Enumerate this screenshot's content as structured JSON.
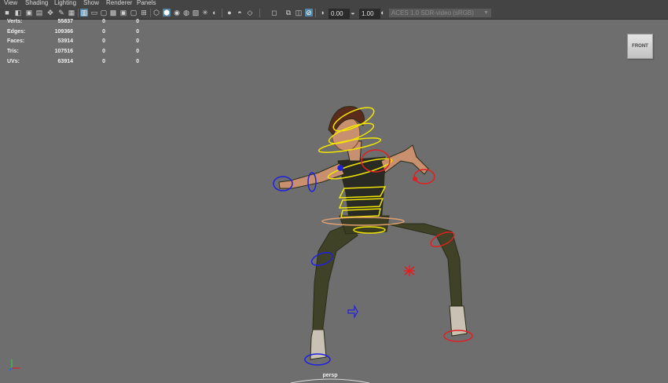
{
  "menu": [
    "View",
    "Shading",
    "Lighting",
    "Show",
    "Renderer",
    "Panels"
  ],
  "toolbar": {
    "exposure_value": "0.00",
    "gamma_value": "1.00",
    "color_space": "ACES 1.0 SDR-video (sRGB)",
    "icons": [
      "camera-select-icon",
      "camera-attributes-icon",
      "bookmarks-icon",
      "image-plane-icon",
      "2d-pan-zoom-icon",
      "grease-pencil-icon",
      "grid-icon",
      "film-gate-icon",
      "resolution-gate-icon",
      "gate-mask-icon",
      "field-chart-icon",
      "safe-action-icon",
      "safe-title-icon",
      "wireframe-icon",
      "smooth-shade-icon",
      "wireframe-on-shaded-icon",
      "textured-icon",
      "use-all-lights-icon",
      "shadows-icon",
      "screen-space-ao-icon",
      "motion-blur-icon",
      "multisample-aa-icon",
      "depth-of-field-icon",
      "isolate-select-icon",
      "xray-icon",
      "xray-joints-icon",
      "backface-icon",
      "exposure-icon",
      "gamma-icon"
    ]
  },
  "hud": {
    "rows": [
      {
        "label": "Verts:",
        "v1": "55837",
        "v2": "0",
        "v3": "0"
      },
      {
        "label": "Edges:",
        "v1": "109366",
        "v2": "0",
        "v3": "0"
      },
      {
        "label": "Faces:",
        "v1": "53914",
        "v2": "0",
        "v3": "0"
      },
      {
        "label": "Tris:",
        "v1": "107516",
        "v2": "0",
        "v3": "0"
      },
      {
        "label": "UVs:",
        "v1": "63914",
        "v2": "0",
        "v3": "0"
      }
    ]
  },
  "viewcube": {
    "label": "FRONT"
  },
  "camera": {
    "name": "persp"
  },
  "colors": {
    "viewport_bg": "#6e6e6e",
    "toolbar_bg": "#444444",
    "active_icon": "#5285a6",
    "ctrl_yellow": "#f2e600",
    "ctrl_blue": "#2020e0",
    "ctrl_red": "#e02020"
  }
}
